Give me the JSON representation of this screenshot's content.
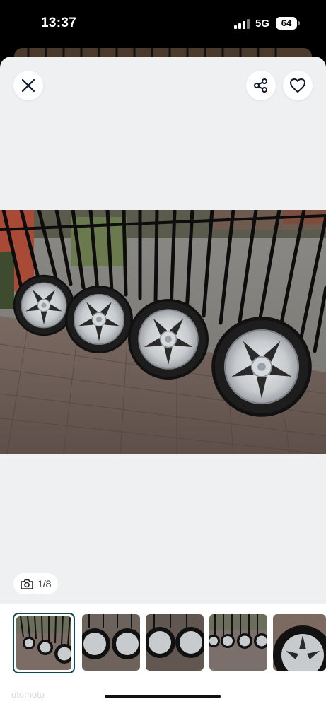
{
  "status_bar": {
    "time": "13:37",
    "network": "5G",
    "battery": "64"
  },
  "header": {
    "close_icon": "close-icon",
    "share_icon": "share-icon",
    "favorite_icon": "heart-icon"
  },
  "gallery": {
    "counter": "1/8",
    "counter_icon": "camera-icon",
    "thumbnails": [
      {
        "name": "thumbnail-1",
        "active": true
      },
      {
        "name": "thumbnail-2",
        "active": false
      },
      {
        "name": "thumbnail-3",
        "active": false
      },
      {
        "name": "thumbnail-4",
        "active": false
      },
      {
        "name": "thumbnail-5",
        "active": false
      }
    ]
  },
  "watermark": "otomoto",
  "colors": {
    "sheet_bg": "#eef0f2",
    "active_thumb_border": "#0c4b4f"
  }
}
